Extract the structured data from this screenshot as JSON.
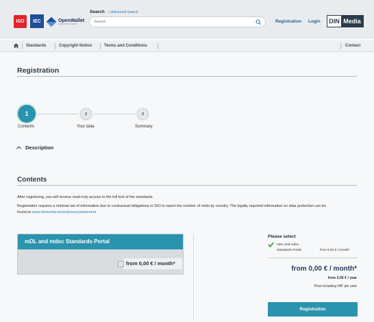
{
  "header": {
    "logos": {
      "iso": "ISO",
      "iec": "IEC",
      "iec_sub": "",
      "openwallet": "OpenWallet",
      "openwallet_sub": "FOUNDATION",
      "din_a": "DIN",
      "din_b": "Media"
    },
    "search_label": "Search",
    "advanced_search": "» Advanced Search",
    "search_placeholder": "Search",
    "registration_link": "Registration",
    "login_link": "Login"
  },
  "nav": {
    "items": [
      "Standards",
      "Copyright Notice",
      "Terms and Conditions"
    ],
    "contact": "Contact"
  },
  "page_title": "Registration",
  "steps": [
    {
      "number": "1",
      "label": "Contents"
    },
    {
      "number": "2",
      "label": "Your data"
    },
    {
      "number": "3",
      "label": "Summary"
    }
  ],
  "description_toggle": "Description",
  "contents": {
    "title": "Contents",
    "para1": "After registering, you will receive read-only access to the full text of the standards.",
    "para2": "Registration requires a minimal set of information due to contractual obligations to ISO to report the number of visits by country. The legally required information on data protection can be",
    "para2_prefix": "found at ",
    "privacy_link": "www.dinmedia.de/en/privacystatement"
  },
  "product_card": {
    "title": "mDL and mdoc Standards Portal",
    "price": "from 0,00 € / month*"
  },
  "summary": {
    "please_select": "Please select",
    "item_line1": "mDL and mdoc",
    "item_line2": "Standards Portal",
    "item_price": "from 0,00 € / month*",
    "big_price": "from 0,00 € / month*",
    "year_price": "from 0,00 € / year",
    "vat_note": "Price including VAT per year",
    "register_button": "Registration"
  },
  "colors": {
    "accent": "#2a93ad",
    "link": "#2a7fb8",
    "iso_red": "#e0252b",
    "iec_blue": "#1f4e9a",
    "check_green": "#3aa33a"
  }
}
